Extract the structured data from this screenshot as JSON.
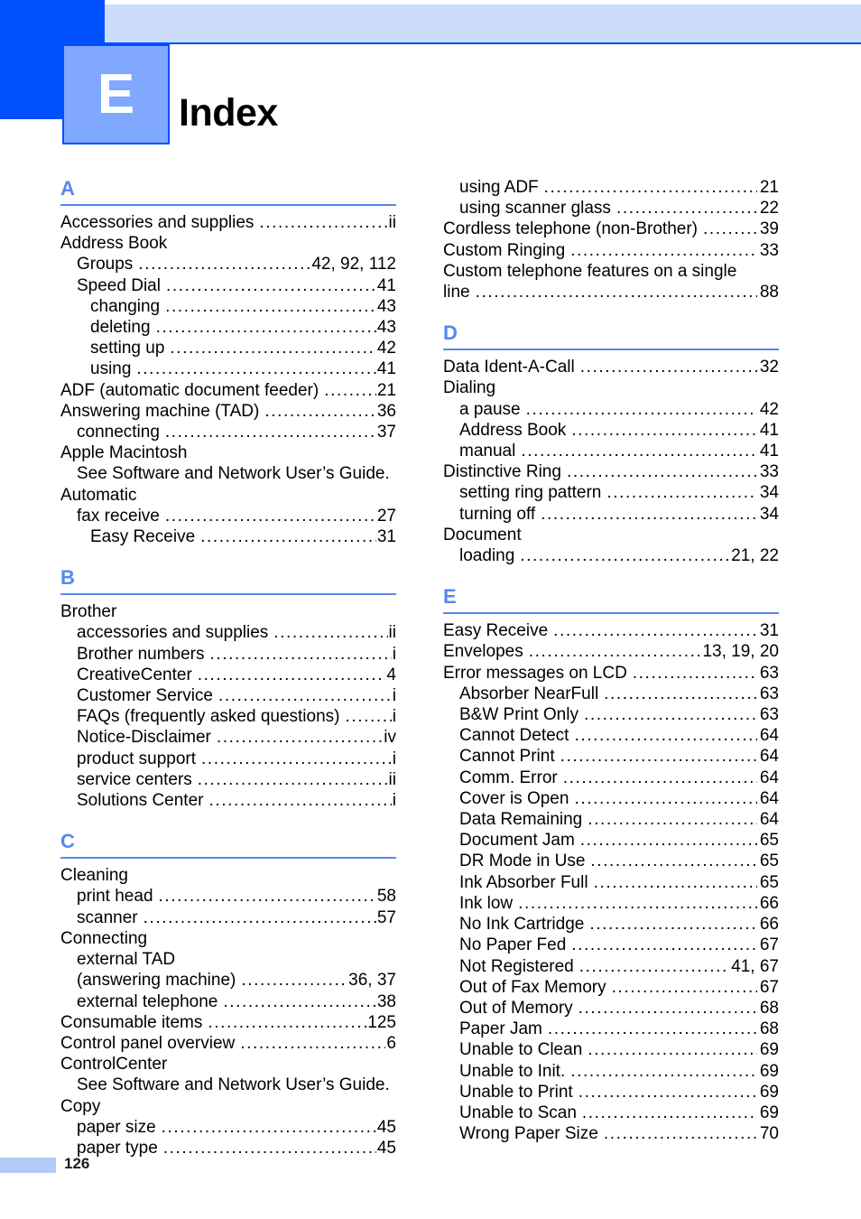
{
  "header": {
    "chapter_letter": "E",
    "title": "Index",
    "colors": {
      "dark_blue": "#0050FF",
      "light_blue_band": "#CCDCFA",
      "badge_blue": "#80A8FF",
      "section_blue": "#5588EE",
      "footer_bar": "#B3CCF7"
    }
  },
  "footer": {
    "page_number": "126"
  },
  "columns": [
    {
      "id": "left",
      "sections": [
        {
          "letter": "A",
          "entries": [
            {
              "level": 0,
              "label": "Accessories and supplies",
              "pages": "ii"
            },
            {
              "level": 0,
              "label": "Address Book",
              "pages": ""
            },
            {
              "level": 1,
              "label": "Groups",
              "pages": "42, 92, 112"
            },
            {
              "level": 1,
              "label": "Speed Dial",
              "pages": "41"
            },
            {
              "level": 2,
              "label": "changing",
              "pages": "43"
            },
            {
              "level": 2,
              "label": "deleting",
              "pages": "43"
            },
            {
              "level": 2,
              "label": "setting up",
              "pages": "42"
            },
            {
              "level": 2,
              "label": "using",
              "pages": "41"
            },
            {
              "level": 0,
              "label": "ADF (automatic document feeder)",
              "pages": "21"
            },
            {
              "level": 0,
              "label": "Answering machine (TAD)",
              "pages": "36"
            },
            {
              "level": 1,
              "label": "connecting",
              "pages": "37"
            },
            {
              "level": 0,
              "label": "Apple Macintosh",
              "pages": ""
            },
            {
              "level": 1,
              "label": "See Software and Network User’s Guide.",
              "pages": ""
            },
            {
              "level": 0,
              "label": "Automatic",
              "pages": ""
            },
            {
              "level": 1,
              "label": "fax receive",
              "pages": "27"
            },
            {
              "level": 2,
              "label": "Easy Receive",
              "pages": "31"
            }
          ]
        },
        {
          "letter": "B",
          "entries": [
            {
              "level": 0,
              "label": "Brother",
              "pages": ""
            },
            {
              "level": 1,
              "label": "accessories and supplies",
              "pages": "ii"
            },
            {
              "level": 1,
              "label": "Brother numbers",
              "pages": "i"
            },
            {
              "level": 1,
              "label": "CreativeCenter",
              "pages": "4"
            },
            {
              "level": 1,
              "label": "Customer Service",
              "pages": "i"
            },
            {
              "level": 1,
              "label": "FAQs (frequently asked questions)",
              "pages": "i"
            },
            {
              "level": 1,
              "label": "Notice-Disclaimer",
              "pages": "iv"
            },
            {
              "level": 1,
              "label": "product support",
              "pages": "i"
            },
            {
              "level": 1,
              "label": "service centers",
              "pages": "ii"
            },
            {
              "level": 1,
              "label": "Solutions Center",
              "pages": "i"
            }
          ]
        },
        {
          "letter": "C",
          "entries": [
            {
              "level": 0,
              "label": "Cleaning",
              "pages": ""
            },
            {
              "level": 1,
              "label": "print head",
              "pages": "58"
            },
            {
              "level": 1,
              "label": "scanner",
              "pages": "57"
            },
            {
              "level": 0,
              "label": "Connecting",
              "pages": ""
            },
            {
              "level": 1,
              "label": "external TAD",
              "pages": ""
            },
            {
              "level": 1,
              "label": "(answering machine)",
              "pages": "36, 37"
            },
            {
              "level": 1,
              "label": "external telephone",
              "pages": "38"
            },
            {
              "level": 0,
              "label": "Consumable items",
              "pages": "125"
            },
            {
              "level": 0,
              "label": "Control panel overview",
              "pages": "6"
            },
            {
              "level": 0,
              "label": "ControlCenter",
              "pages": ""
            },
            {
              "level": 1,
              "label": "See Software and Network User’s Guide.",
              "pages": ""
            },
            {
              "level": 0,
              "label": "Copy",
              "pages": ""
            },
            {
              "level": 1,
              "label": "paper size",
              "pages": "45"
            },
            {
              "level": 1,
              "label": "paper type",
              "pages": "45"
            }
          ]
        }
      ]
    },
    {
      "id": "right",
      "sections": [
        {
          "letter": "",
          "entries": [
            {
              "level": 1,
              "label": "using ADF",
              "pages": "21"
            },
            {
              "level": 1,
              "label": "using scanner glass",
              "pages": "22"
            },
            {
              "level": 0,
              "label": "Cordless telephone (non-Brother)",
              "pages": "39"
            },
            {
              "level": 0,
              "label": "Custom Ringing",
              "pages": "33"
            },
            {
              "level": 0,
              "label": "Custom telephone features on a single",
              "pages": ""
            },
            {
              "level": 0,
              "label": "line",
              "pages": "88"
            }
          ]
        },
        {
          "letter": "D",
          "entries": [
            {
              "level": 0,
              "label": "Data Ident-A-Call",
              "pages": "32"
            },
            {
              "level": 0,
              "label": "Dialing",
              "pages": ""
            },
            {
              "level": 1,
              "label": "a pause",
              "pages": "42"
            },
            {
              "level": 1,
              "label": "Address Book",
              "pages": "41"
            },
            {
              "level": 1,
              "label": "manual",
              "pages": "41"
            },
            {
              "level": 0,
              "label": "Distinctive Ring",
              "pages": "33"
            },
            {
              "level": 1,
              "label": "setting ring pattern",
              "pages": "34"
            },
            {
              "level": 1,
              "label": "turning off",
              "pages": "34"
            },
            {
              "level": 0,
              "label": "Document",
              "pages": ""
            },
            {
              "level": 1,
              "label": "loading",
              "pages": "21, 22"
            }
          ]
        },
        {
          "letter": "E",
          "entries": [
            {
              "level": 0,
              "label": "Easy Receive",
              "pages": "31"
            },
            {
              "level": 0,
              "label": "Envelopes",
              "pages": "13, 19, 20"
            },
            {
              "level": 0,
              "label": "Error messages on LCD",
              "pages": "63"
            },
            {
              "level": 1,
              "label": "Absorber NearFull",
              "pages": "63"
            },
            {
              "level": 1,
              "label": "B&W Print Only",
              "pages": "63"
            },
            {
              "level": 1,
              "label": "Cannot Detect",
              "pages": "64"
            },
            {
              "level": 1,
              "label": "Cannot Print",
              "pages": "64"
            },
            {
              "level": 1,
              "label": "Comm. Error",
              "pages": "64"
            },
            {
              "level": 1,
              "label": "Cover is Open",
              "pages": "64"
            },
            {
              "level": 1,
              "label": "Data Remaining",
              "pages": "64"
            },
            {
              "level": 1,
              "label": "Document Jam",
              "pages": "65"
            },
            {
              "level": 1,
              "label": "DR Mode in Use",
              "pages": "65"
            },
            {
              "level": 1,
              "label": "Ink Absorber Full",
              "pages": "65"
            },
            {
              "level": 1,
              "label": "Ink low",
              "pages": "66"
            },
            {
              "level": 1,
              "label": "No Ink Cartridge",
              "pages": "66"
            },
            {
              "level": 1,
              "label": "No Paper Fed",
              "pages": "67"
            },
            {
              "level": 1,
              "label": "Not Registered",
              "pages": "41, 67"
            },
            {
              "level": 1,
              "label": "Out of Fax Memory",
              "pages": "67"
            },
            {
              "level": 1,
              "label": "Out of Memory",
              "pages": "68"
            },
            {
              "level": 1,
              "label": "Paper Jam",
              "pages": "68"
            },
            {
              "level": 1,
              "label": "Unable to Clean",
              "pages": "69"
            },
            {
              "level": 1,
              "label": "Unable to Init.",
              "pages": "69"
            },
            {
              "level": 1,
              "label": "Unable to Print",
              "pages": "69"
            },
            {
              "level": 1,
              "label": "Unable to Scan",
              "pages": "69"
            },
            {
              "level": 1,
              "label": "Wrong Paper Size",
              "pages": "70"
            }
          ]
        }
      ]
    }
  ]
}
